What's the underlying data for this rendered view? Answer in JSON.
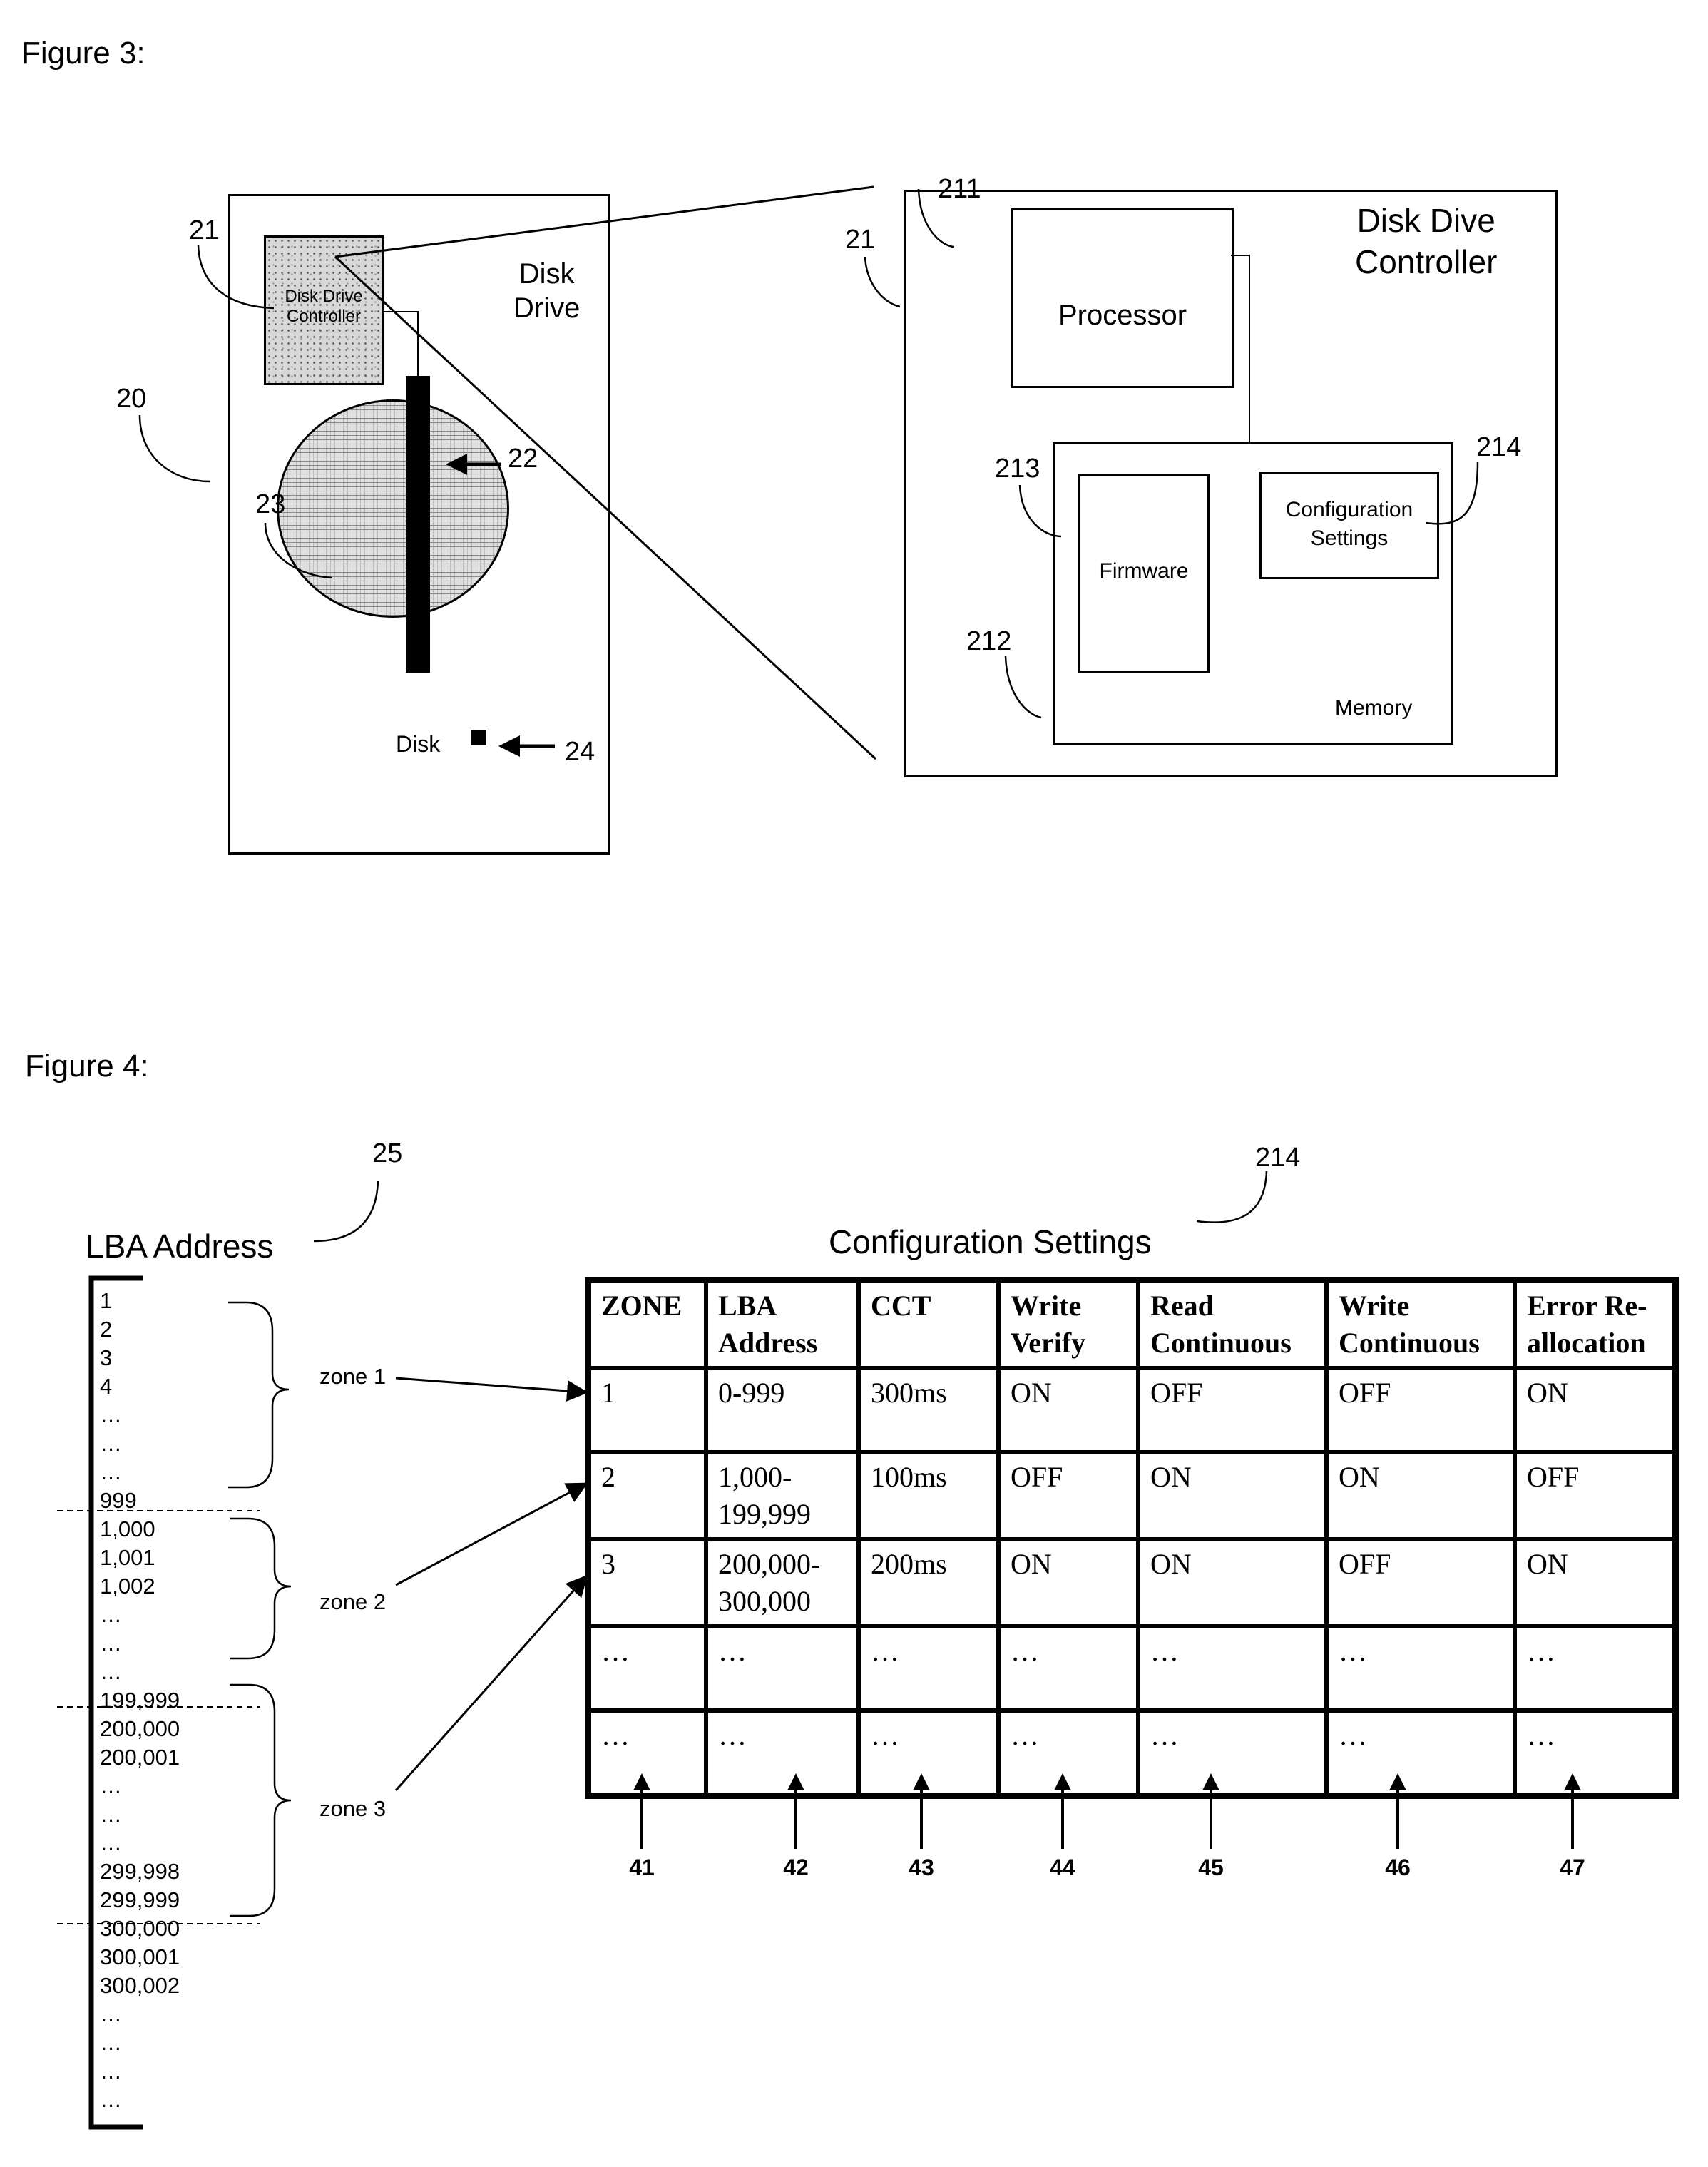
{
  "figure3": {
    "title": "Figure 3:",
    "disk_drive": {
      "label_line1": "Disk",
      "label_line2": "Drive",
      "ref": "20",
      "controller_label_line1": "Disk Drive",
      "controller_label_line2": "Controller",
      "controller_ref": "21",
      "arm_ref": "22",
      "disk_ref": "23",
      "disk_label": "Disk",
      "sector_ref": "24"
    },
    "controller_detail": {
      "title_line1": "Disk Dive",
      "title_line2": "Controller",
      "ref": "21",
      "processor_label": "Processor",
      "processor_ref": "211",
      "memory_label": "Memory",
      "memory_ref": "212",
      "firmware_label": "Firmware",
      "firmware_ref": "213",
      "config_label_line1": "Configuration",
      "config_label_line2": "Settings",
      "config_ref": "214"
    }
  },
  "figure4": {
    "title": "Figure 4:",
    "lba_header": "LBA Address",
    "lba_ref": "25",
    "lba_list": [
      "1",
      "2",
      "3",
      "4",
      "…",
      "…",
      "…",
      "999",
      "1,000",
      "1,001",
      "1,002",
      "…",
      "…",
      "…",
      "199,999",
      "200,000",
      "200,001",
      "…",
      "…",
      "…",
      "299,998",
      "299,999",
      "300,000",
      "300,001",
      "300,002",
      "…",
      "…",
      "…",
      "…"
    ],
    "zones": [
      {
        "label": "zone 1"
      },
      {
        "label": "zone 2"
      },
      {
        "label": "zone 3"
      }
    ],
    "table_title": "Configuration Settings",
    "table_ref": "214",
    "table": {
      "columns": [
        "ZONE",
        "LBA Address",
        "CCT",
        "Write Verify",
        "Read Continuous",
        "Write Continuous",
        "Error Re-allocation"
      ],
      "rows": [
        [
          "1",
          "0-999",
          "300ms",
          "ON",
          "OFF",
          "OFF",
          "ON"
        ],
        [
          "2",
          "1,000-199,999",
          "100ms",
          "OFF",
          "ON",
          "ON",
          "OFF"
        ],
        [
          "3",
          "200,000-300,000",
          "200ms",
          "ON",
          "ON",
          "OFF",
          "ON"
        ],
        [
          "…",
          "…",
          "…",
          "…",
          "…",
          "…",
          "…"
        ],
        [
          "…",
          "…",
          "…",
          "…",
          "…",
          "…",
          "…"
        ]
      ]
    },
    "column_refs": [
      "41",
      "42",
      "43",
      "44",
      "45",
      "46",
      "47"
    ]
  }
}
